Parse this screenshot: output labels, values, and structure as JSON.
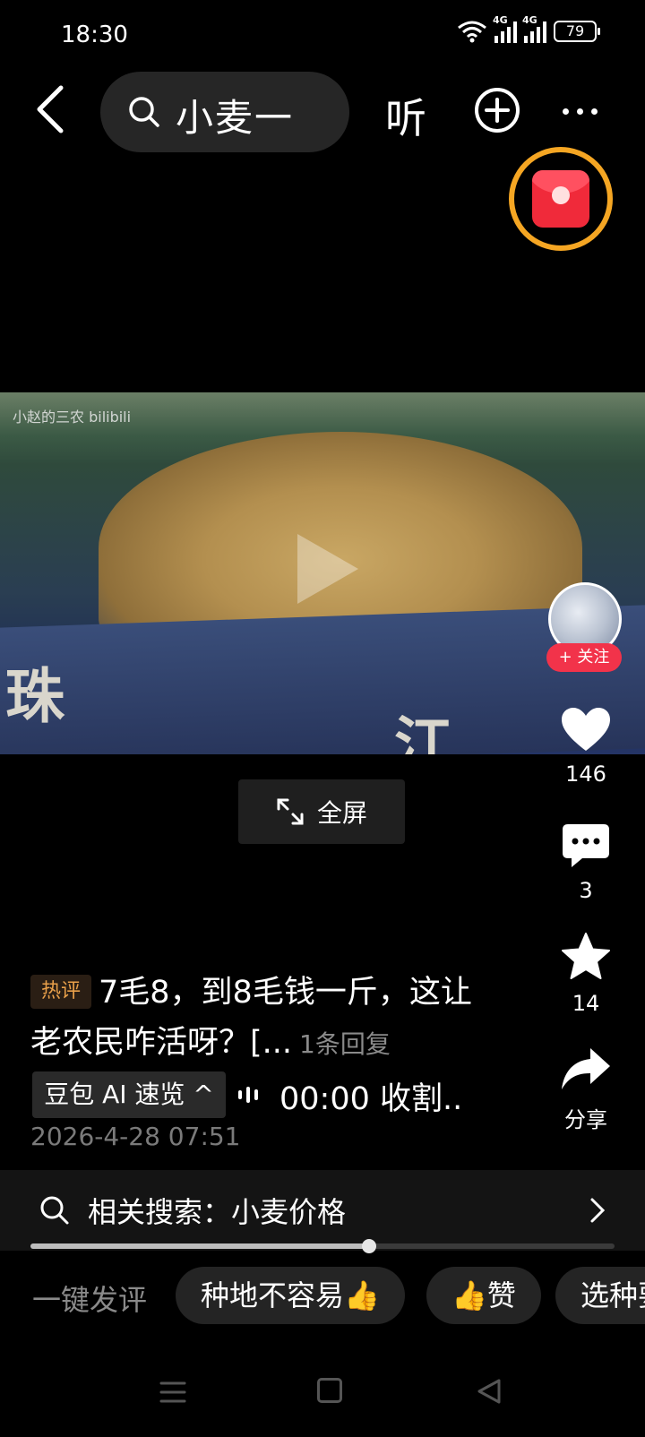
{
  "status_bar": {
    "time": "18:30",
    "network_1": "4G",
    "network_2": "4G",
    "battery": "79"
  },
  "top_nav": {
    "search_query": "小麦一",
    "listen_label": "听"
  },
  "video": {
    "watermark": "小赵的三农 bilibili",
    "truck_text_left": "珠",
    "truck_text_right": "江",
    "fullscreen_label": "全屏"
  },
  "side_actions": {
    "follow_label": "+ 关注",
    "likes": "146",
    "comments": "3",
    "favorites": "14",
    "share_label": "分享"
  },
  "hot_comment": {
    "badge": "热评",
    "text": "7毛8，到8毛钱一斤，这让老农民咋活呀？[...",
    "reply_count": "1条回复"
  },
  "ai_summary": {
    "button_label": "豆包 AI 速览 ^",
    "audio_title": "00:00 收割.."
  },
  "timestamp": "2026-4-28 07:51",
  "related_search": {
    "label": "相关搜索：小麦价格"
  },
  "playback": {
    "progress_percent": 58
  },
  "quick_comment": {
    "label": "一键发评",
    "chips": [
      "种地不容易👍",
      "👍赞",
      "选种要"
    ]
  },
  "colors": {
    "accent_red": "#f2334a",
    "ring_orange": "#f5a623",
    "hot_badge": "#e9a04a"
  }
}
